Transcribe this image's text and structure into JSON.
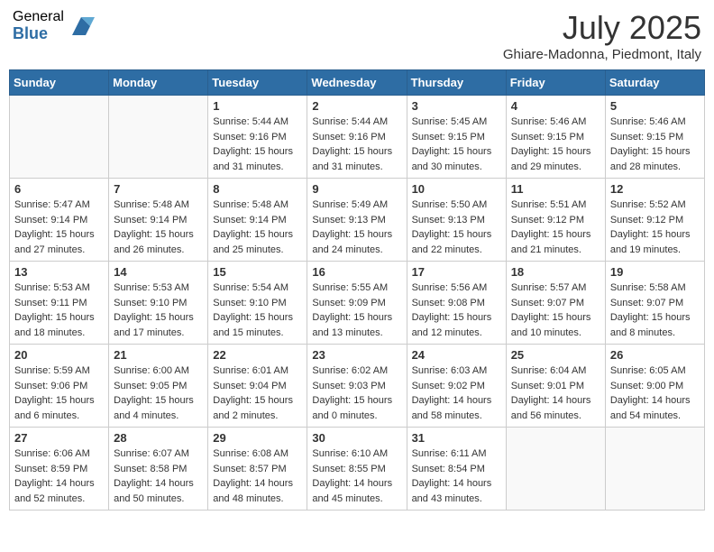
{
  "header": {
    "logo_general": "General",
    "logo_blue": "Blue",
    "month_title": "July 2025",
    "subtitle": "Ghiare-Madonna, Piedmont, Italy"
  },
  "days_of_week": [
    "Sunday",
    "Monday",
    "Tuesday",
    "Wednesday",
    "Thursday",
    "Friday",
    "Saturday"
  ],
  "weeks": [
    [
      {
        "num": "",
        "detail": ""
      },
      {
        "num": "",
        "detail": ""
      },
      {
        "num": "1",
        "detail": "Sunrise: 5:44 AM\nSunset: 9:16 PM\nDaylight: 15 hours and 31 minutes."
      },
      {
        "num": "2",
        "detail": "Sunrise: 5:44 AM\nSunset: 9:16 PM\nDaylight: 15 hours and 31 minutes."
      },
      {
        "num": "3",
        "detail": "Sunrise: 5:45 AM\nSunset: 9:15 PM\nDaylight: 15 hours and 30 minutes."
      },
      {
        "num": "4",
        "detail": "Sunrise: 5:46 AM\nSunset: 9:15 PM\nDaylight: 15 hours and 29 minutes."
      },
      {
        "num": "5",
        "detail": "Sunrise: 5:46 AM\nSunset: 9:15 PM\nDaylight: 15 hours and 28 minutes."
      }
    ],
    [
      {
        "num": "6",
        "detail": "Sunrise: 5:47 AM\nSunset: 9:14 PM\nDaylight: 15 hours and 27 minutes."
      },
      {
        "num": "7",
        "detail": "Sunrise: 5:48 AM\nSunset: 9:14 PM\nDaylight: 15 hours and 26 minutes."
      },
      {
        "num": "8",
        "detail": "Sunrise: 5:48 AM\nSunset: 9:14 PM\nDaylight: 15 hours and 25 minutes."
      },
      {
        "num": "9",
        "detail": "Sunrise: 5:49 AM\nSunset: 9:13 PM\nDaylight: 15 hours and 24 minutes."
      },
      {
        "num": "10",
        "detail": "Sunrise: 5:50 AM\nSunset: 9:13 PM\nDaylight: 15 hours and 22 minutes."
      },
      {
        "num": "11",
        "detail": "Sunrise: 5:51 AM\nSunset: 9:12 PM\nDaylight: 15 hours and 21 minutes."
      },
      {
        "num": "12",
        "detail": "Sunrise: 5:52 AM\nSunset: 9:12 PM\nDaylight: 15 hours and 19 minutes."
      }
    ],
    [
      {
        "num": "13",
        "detail": "Sunrise: 5:53 AM\nSunset: 9:11 PM\nDaylight: 15 hours and 18 minutes."
      },
      {
        "num": "14",
        "detail": "Sunrise: 5:53 AM\nSunset: 9:10 PM\nDaylight: 15 hours and 17 minutes."
      },
      {
        "num": "15",
        "detail": "Sunrise: 5:54 AM\nSunset: 9:10 PM\nDaylight: 15 hours and 15 minutes."
      },
      {
        "num": "16",
        "detail": "Sunrise: 5:55 AM\nSunset: 9:09 PM\nDaylight: 15 hours and 13 minutes."
      },
      {
        "num": "17",
        "detail": "Sunrise: 5:56 AM\nSunset: 9:08 PM\nDaylight: 15 hours and 12 minutes."
      },
      {
        "num": "18",
        "detail": "Sunrise: 5:57 AM\nSunset: 9:07 PM\nDaylight: 15 hours and 10 minutes."
      },
      {
        "num": "19",
        "detail": "Sunrise: 5:58 AM\nSunset: 9:07 PM\nDaylight: 15 hours and 8 minutes."
      }
    ],
    [
      {
        "num": "20",
        "detail": "Sunrise: 5:59 AM\nSunset: 9:06 PM\nDaylight: 15 hours and 6 minutes."
      },
      {
        "num": "21",
        "detail": "Sunrise: 6:00 AM\nSunset: 9:05 PM\nDaylight: 15 hours and 4 minutes."
      },
      {
        "num": "22",
        "detail": "Sunrise: 6:01 AM\nSunset: 9:04 PM\nDaylight: 15 hours and 2 minutes."
      },
      {
        "num": "23",
        "detail": "Sunrise: 6:02 AM\nSunset: 9:03 PM\nDaylight: 15 hours and 0 minutes."
      },
      {
        "num": "24",
        "detail": "Sunrise: 6:03 AM\nSunset: 9:02 PM\nDaylight: 14 hours and 58 minutes."
      },
      {
        "num": "25",
        "detail": "Sunrise: 6:04 AM\nSunset: 9:01 PM\nDaylight: 14 hours and 56 minutes."
      },
      {
        "num": "26",
        "detail": "Sunrise: 6:05 AM\nSunset: 9:00 PM\nDaylight: 14 hours and 54 minutes."
      }
    ],
    [
      {
        "num": "27",
        "detail": "Sunrise: 6:06 AM\nSunset: 8:59 PM\nDaylight: 14 hours and 52 minutes."
      },
      {
        "num": "28",
        "detail": "Sunrise: 6:07 AM\nSunset: 8:58 PM\nDaylight: 14 hours and 50 minutes."
      },
      {
        "num": "29",
        "detail": "Sunrise: 6:08 AM\nSunset: 8:57 PM\nDaylight: 14 hours and 48 minutes."
      },
      {
        "num": "30",
        "detail": "Sunrise: 6:10 AM\nSunset: 8:55 PM\nDaylight: 14 hours and 45 minutes."
      },
      {
        "num": "31",
        "detail": "Sunrise: 6:11 AM\nSunset: 8:54 PM\nDaylight: 14 hours and 43 minutes."
      },
      {
        "num": "",
        "detail": ""
      },
      {
        "num": "",
        "detail": ""
      }
    ]
  ]
}
